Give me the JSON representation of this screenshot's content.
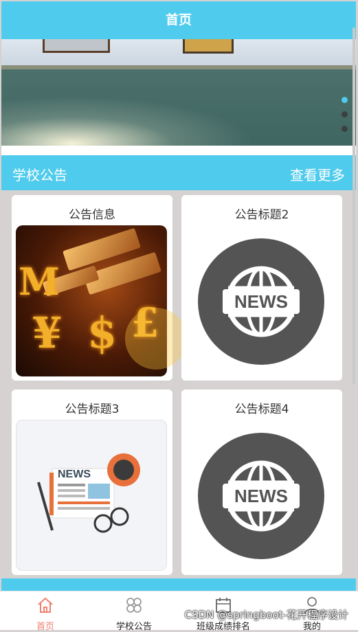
{
  "header": {
    "title": "首页"
  },
  "banner": {
    "active_index": 0,
    "dot_count": 3
  },
  "notices": {
    "section_title": "学校公告",
    "more_label": "查看更多",
    "cards": [
      {
        "title": "公告信息",
        "image": "money-currency-image"
      },
      {
        "title": "公告标题2",
        "image": "news-globe-icon",
        "badge": "NEWS"
      },
      {
        "title": "公告标题3",
        "image": "newspaper-coffee-illustration",
        "badge": "NEWS"
      },
      {
        "title": "公告标题4",
        "image": "news-globe-icon",
        "badge": "NEWS"
      }
    ]
  },
  "tabbar": {
    "items": [
      {
        "label": "首页",
        "icon": "home-icon",
        "active": true
      },
      {
        "label": "学校公告",
        "icon": "grid-icon",
        "active": false
      },
      {
        "label": "班级成绩排名",
        "icon": "calendar-icon",
        "active": false
      },
      {
        "label": "我的",
        "icon": "user-icon",
        "active": false
      }
    ]
  },
  "watermark": "CSDN @springboot-花开程序设计",
  "colors": {
    "accent": "#4fcbed",
    "active_tab": "#f08070"
  }
}
